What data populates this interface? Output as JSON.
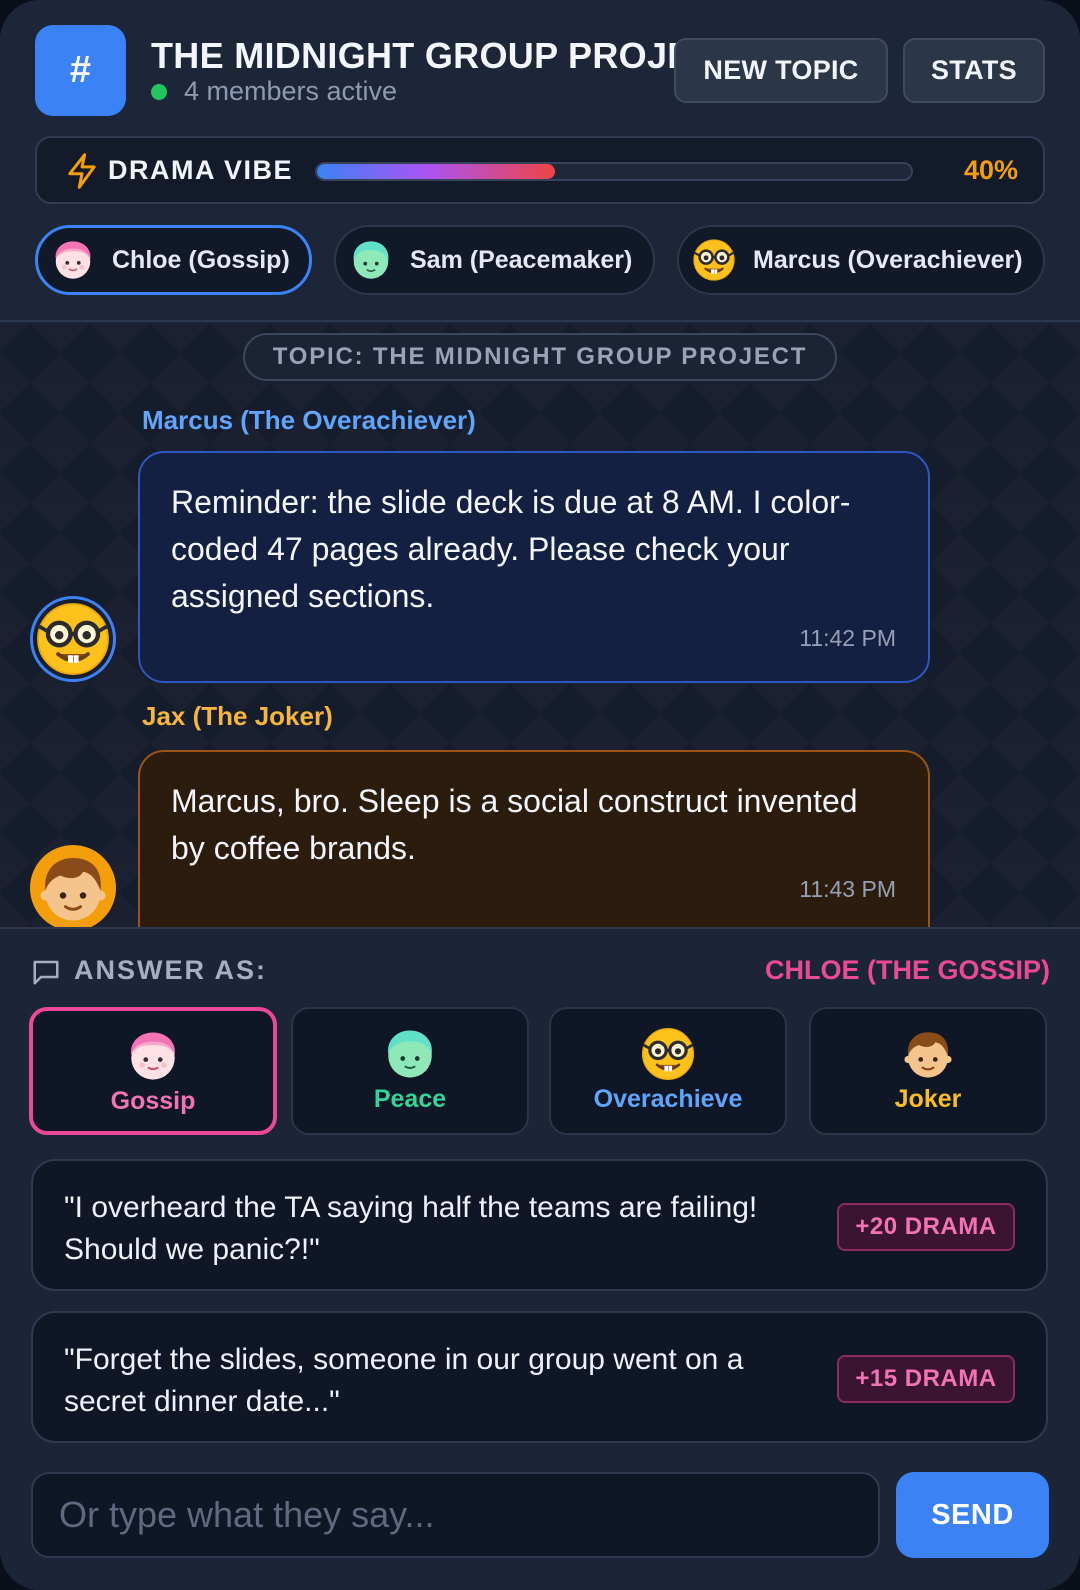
{
  "header": {
    "icon_glyph": "#",
    "title": "THE MIDNIGHT GROUP PROJECT",
    "status": "4 members active",
    "new_topic_label": "NEW TOPIC",
    "stats_label": "STATS"
  },
  "drama": {
    "icon": "lightning-bolt-icon",
    "label": "DRAMA VIBE",
    "value_percent": 40,
    "value_text": "40%"
  },
  "members": [
    {
      "label": "Chloe (Gossip)",
      "avatar": "pink-hair-face-icon",
      "active": true
    },
    {
      "label": "Sam (Peacemaker)",
      "avatar": "green-hair-face-icon",
      "active": false
    },
    {
      "label": "Marcus (Overachiever)",
      "avatar": "nerd-face-icon",
      "active": false
    }
  ],
  "chat": {
    "topic": "TOPIC: THE MIDNIGHT GROUP PROJECT",
    "messages": [
      {
        "sender": "Marcus (The Overachiever)",
        "avatar": "nerd-face-icon",
        "text": "Reminder: the slide deck is due at 8 AM. I color-coded 47 pages already. Please check your assigned sections.",
        "time": "11:42 PM"
      },
      {
        "sender": "Jax (The Joker)",
        "avatar": "boy-face-icon",
        "text": "Marcus, bro. Sleep is a social construct invented by coffee brands.",
        "time": "11:43 PM"
      }
    ]
  },
  "answer": {
    "label": "ANSWER AS:",
    "current": "CHLOE (THE GOSSIP)",
    "personas": [
      {
        "label": "Gossip",
        "avatar": "pink-hair-face-icon",
        "active": true
      },
      {
        "label": "Peace",
        "avatar": "green-hair-face-icon",
        "active": false
      },
      {
        "label": "Overachieve",
        "avatar": "nerd-face-icon",
        "active": false
      },
      {
        "label": "Joker",
        "avatar": "boy-face-icon",
        "active": false
      }
    ],
    "options": [
      {
        "text": "\"I overheard the TA saying half the teams are failing! Should we panic?!\"",
        "badge": "+20 DRAMA"
      },
      {
        "text": "\"Forget the slides, someone in our group went on a secret dinner date...\"",
        "badge": "+15 DRAMA"
      }
    ],
    "input_placeholder": "Or type what they say...",
    "send_label": "SEND"
  },
  "colors": {
    "accent": "#3b82f6",
    "gossip": "#ec4899",
    "peace": "#34d399",
    "overachiever": "#60a5fa",
    "joker": "#fbbf24",
    "drama_value": "#f59e0b"
  }
}
